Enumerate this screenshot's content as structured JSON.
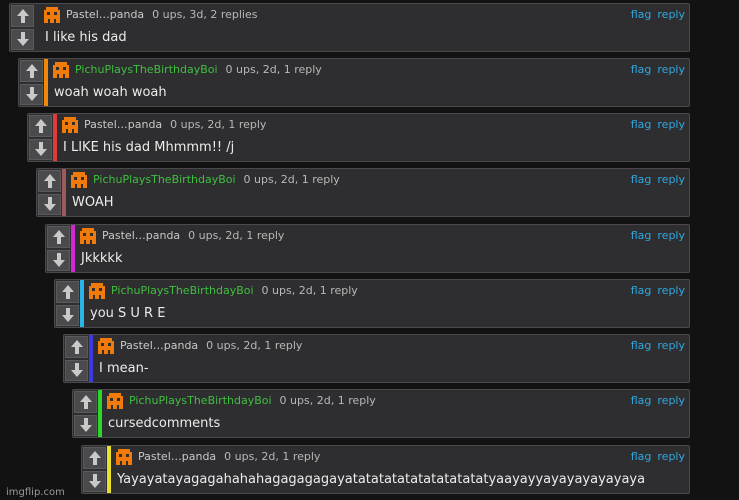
{
  "labels": {
    "flag": "flag",
    "reply": "reply"
  },
  "watermark": "imgflip.com",
  "comments": [
    {
      "user": "Pastel…panda",
      "user_color": "#c9c9c9",
      "meta": "0 ups, 3d, 2 replies",
      "text": "I like his dad",
      "bar_color": ""
    },
    {
      "user": "PichuPlaysTheBirthdayBoi",
      "user_color": "#3fbf3f",
      "meta": "0 ups, 2d, 1 reply",
      "text": "woah woah woah",
      "bar_color": "#f0880a"
    },
    {
      "user": "Pastel…panda",
      "user_color": "#c9c9c9",
      "meta": "0 ups, 2d, 1 reply",
      "text": "I LIKE his dad Mhmmm!! /j",
      "bar_color": "#e03a3a"
    },
    {
      "user": "PichuPlaysTheBirthdayBoi",
      "user_color": "#3fbf3f",
      "meta": "0 ups, 2d, 1 reply",
      "text": "WOAH",
      "bar_color": "#9c5a5a"
    },
    {
      "user": "Pastel…panda",
      "user_color": "#c9c9c9",
      "meta": "0 ups, 2d, 1 reply",
      "text": "Jkkkkk",
      "bar_color": "#d02ad0"
    },
    {
      "user": "PichuPlaysTheBirthdayBoi",
      "user_color": "#3fbf3f",
      "meta": "0 ups, 2d, 1 reply",
      "text": "you S U R E",
      "bar_color": "#2ab4e8"
    },
    {
      "user": "Pastel…panda",
      "user_color": "#c9c9c9",
      "meta": "0 ups, 2d, 1 reply",
      "text": "I mean-",
      "bar_color": "#3a3ae0"
    },
    {
      "user": "PichuPlaysTheBirthdayBoi",
      "user_color": "#3fbf3f",
      "meta": "0 ups, 2d, 1 reply",
      "text": "cursedcomments",
      "bar_color": "#2ad82a"
    },
    {
      "user": "Pastel…panda",
      "user_color": "#c9c9c9",
      "meta": "0 ups, 2d, 1 reply",
      "text": "Yayayatayagagahahahagagagagayatatatatatatatatatatatyaayayyayayayayayaya",
      "bar_color": "#e8e02a"
    }
  ]
}
